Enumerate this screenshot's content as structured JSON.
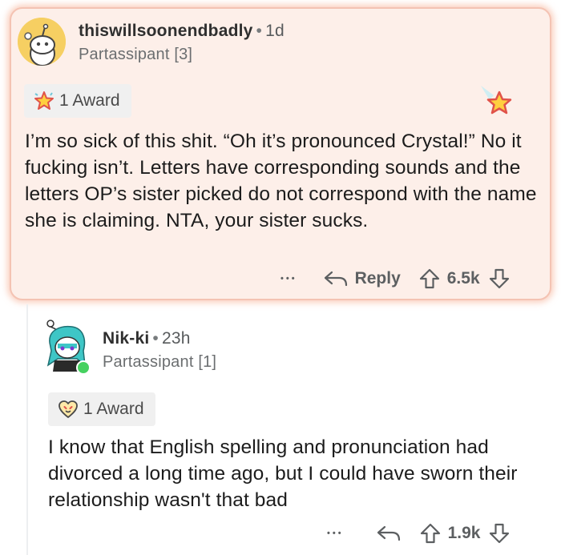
{
  "comments": [
    {
      "username": "thiswillsoonendbadly",
      "separator": "•",
      "age": "1d",
      "flair": "Partassipant [3]",
      "award_label": "1 Award",
      "body": "I’m so sick of this shit. “Oh it’s pronounced Crystal!” No it fucking isn’t. Letters have corresponding sounds and the letters OP’s sister picked do not correspond with the name she is claiming. NTA, your sister sucks.",
      "more": "•••",
      "reply_label": "Reply",
      "score": "6.5k"
    },
    {
      "username": "Nik-ki",
      "separator": "•",
      "age": "23h",
      "flair": "Partassipant [1]",
      "award_label": "1 Award",
      "body": "I know that English spelling and pronunciation had divorced a long time ago, but I could have sworn their relationship wasn't that bad",
      "more": "•••",
      "score": "1.9k"
    }
  ],
  "colors": {
    "highlight_bg": "#fdefe9",
    "highlight_border": "#f4c3b3",
    "online": "#46d160"
  }
}
